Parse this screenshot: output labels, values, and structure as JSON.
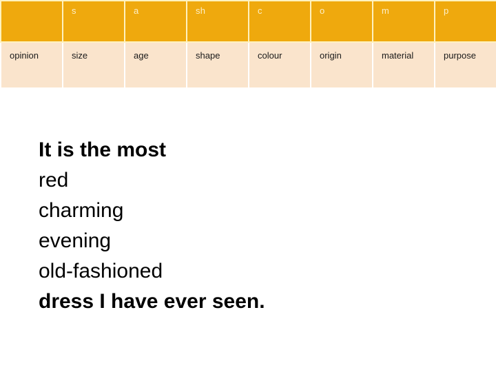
{
  "table": {
    "columns": 8,
    "header_row": {
      "cells": [
        "",
        "s",
        "a",
        "sh",
        "c",
        "o",
        "m",
        "p"
      ]
    },
    "data_row": {
      "cells": [
        "opinion",
        "size",
        "age",
        "shape",
        "colour",
        "origin",
        "material",
        "purpose"
      ]
    },
    "colors": {
      "header_background": "#EFA90D",
      "header_text": "#FCEFC8",
      "header_gridline": "#FFF2BF",
      "data_background": "#FAE4CC",
      "data_text": "#1A1A1A",
      "data_gridline": "#FFFFFF"
    }
  },
  "sentence": {
    "lines": [
      {
        "text": "It is the most",
        "weight": "bold"
      },
      {
        "text": "red",
        "weight": "normal"
      },
      {
        "text": "charming",
        "weight": "normal"
      },
      {
        "text": "evening",
        "weight": "normal"
      },
      {
        "text": "old-fashioned",
        "weight": "normal"
      },
      {
        "text": "dress I have ever seen.",
        "weight": "bold"
      }
    ],
    "text_color": "#000000"
  }
}
